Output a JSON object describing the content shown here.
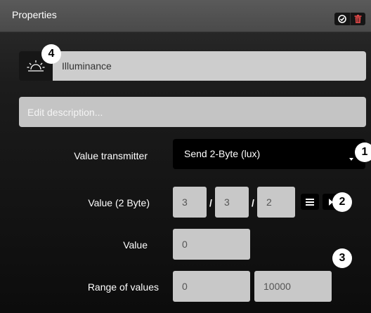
{
  "header": {
    "title": "Properties",
    "icons": [
      "check-circle-icon",
      "trash-icon"
    ]
  },
  "object": {
    "icon": "illuminance-sun-icon",
    "name": "Illuminance"
  },
  "description": {
    "placeholder": "Edit description...",
    "value": ""
  },
  "value_transmitter": {
    "label": "Value transmitter",
    "selected": "Send 2-Byte (lux)"
  },
  "address": {
    "label": "Value (2 Byte)",
    "main": "3",
    "middle": "3",
    "sub": "2",
    "separator": "/"
  },
  "value": {
    "label": "Value",
    "current": "0"
  },
  "range": {
    "label": "Range of values",
    "min": "0",
    "max": "10000"
  },
  "badges": [
    "1",
    "2",
    "3",
    "4"
  ]
}
